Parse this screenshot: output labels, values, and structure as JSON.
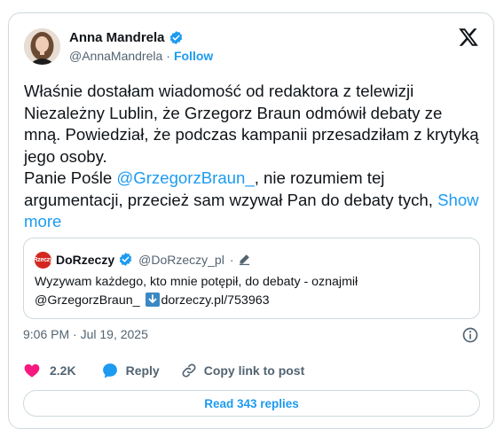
{
  "author": {
    "name": "Anna Mandrela",
    "handle": "@AnnaMandrela",
    "separator": "·",
    "follow_label": "Follow"
  },
  "tweet": {
    "paragraph1": "Właśnie dostałam wiadomość od redaktora z telewizji Niezależny Lublin, że Grzegorz Braun odmówił debaty ze mną. Powiedział, że podczas kampanii przesadziłam z krytyką jego osoby.",
    "p2_before": "Panie Pośle ",
    "p2_mention": "@GrzegorzBraun_",
    "p2_after": ", nie rozumiem tej argumentacji, przecież sam wzywał Pan do debaty tych, ",
    "show_more": "Show more"
  },
  "quote": {
    "logo_text": "Rzeczy",
    "name": "DoRzeczy",
    "handle": "@DoRzeczy_pl",
    "separator": "·",
    "line1": "Wyzywam każdego, kto mnie potępił, do debaty - oznajmił",
    "line2_mention": "@GrzegorzBraun_",
    "line2_link": "dorzeczy.pl/753963"
  },
  "timestamp": "9:06 PM · Jul 19, 2025",
  "actions": {
    "likes": "2.2K",
    "reply_label": "Reply",
    "copy_label": "Copy link to post"
  },
  "read_replies": "Read 343 replies",
  "colors": {
    "accent": "#1d9bf0",
    "like": "#f91880",
    "text": "#0f1419",
    "muted": "#536471",
    "border": "#cfd9de"
  }
}
